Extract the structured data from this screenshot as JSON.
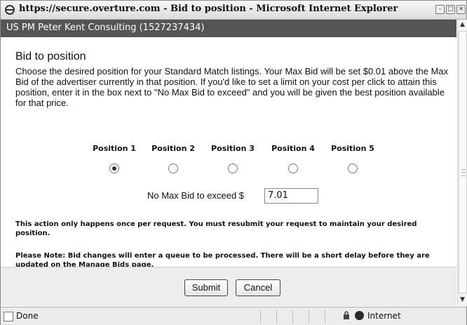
{
  "window": {
    "title": "https://secure.overture.com - Bid to position - Microsoft Internet Explorer",
    "minimize": "-",
    "maximize": "□",
    "close": "×"
  },
  "header": {
    "account": "US PM Peter Kent Consulting (1527237434)"
  },
  "page": {
    "heading": "Bid to position",
    "intro": "Choose the desired position for your Standard Match listings. Your Max Bid will be set $0.01 above the Max Bid of the advertiser currently in that position. If you'd like to set a limit on your cost per click to attain this position, enter it in the box next to \"No Max Bid to exceed\" and you will be given the best position available for that price.",
    "positions": [
      {
        "label": "Position 1",
        "selected": true
      },
      {
        "label": "Position 2",
        "selected": false
      },
      {
        "label": "Position 3",
        "selected": false
      },
      {
        "label": "Position 4",
        "selected": false
      },
      {
        "label": "Position 5",
        "selected": false
      }
    ],
    "max_bid_label": "No Max Bid to exceed $",
    "max_bid_value": "7.01",
    "note_once": "This action only happens once per request. You must resubmit your request to maintain your desired position.",
    "note_queue": "Please Note: Bid changes will enter a queue to be processed. There will be a short delay before they are updated on the Manage Bids page."
  },
  "buttons": {
    "submit": "Submit",
    "cancel": "Cancel"
  },
  "status": {
    "text": "Done",
    "zone": "Internet"
  },
  "icons": [
    "ie-logo-icon",
    "minimize-icon",
    "maximize-icon",
    "close-icon",
    "scroll-up-icon",
    "scroll-down-icon",
    "page-icon",
    "lock-icon",
    "globe-icon"
  ]
}
